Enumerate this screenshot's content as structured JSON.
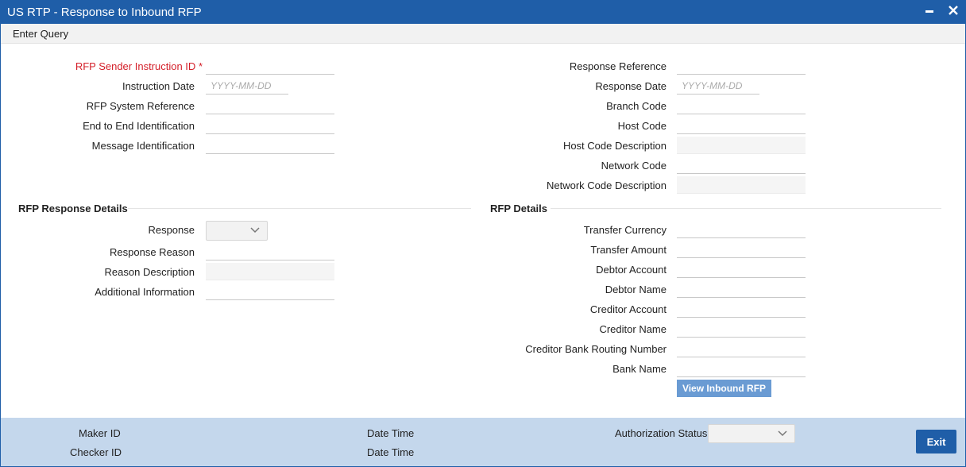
{
  "window": {
    "title": "US RTP - Response to Inbound RFP",
    "minimize_icon": "minimize-icon",
    "close_icon": "close-icon"
  },
  "menu": {
    "enter_query": "Enter Query"
  },
  "header_left": {
    "rfp_sender_instruction_id": {
      "label": "RFP Sender Instruction ID",
      "required_mark": "*",
      "value": ""
    },
    "instruction_date": {
      "label": "Instruction Date",
      "value": "",
      "placeholder": "YYYY-MM-DD"
    },
    "rfp_system_reference": {
      "label": "RFP System Reference",
      "value": ""
    },
    "end_to_end_identification": {
      "label": "End to End Identification",
      "value": ""
    },
    "message_identification": {
      "label": "Message Identification",
      "value": ""
    }
  },
  "header_right": {
    "response_reference": {
      "label": "Response Reference",
      "value": ""
    },
    "response_date": {
      "label": "Response Date",
      "value": "",
      "placeholder": "YYYY-MM-DD"
    },
    "branch_code": {
      "label": "Branch Code",
      "value": ""
    },
    "host_code": {
      "label": "Host Code",
      "value": ""
    },
    "host_code_description": {
      "label": "Host Code Description",
      "value": ""
    },
    "network_code": {
      "label": "Network Code",
      "value": ""
    },
    "network_code_description": {
      "label": "Network Code Description",
      "value": ""
    }
  },
  "rfp_response_details": {
    "title": "RFP Response Details",
    "response": {
      "label": "Response",
      "selected": ""
    },
    "response_reason": {
      "label": "Response Reason",
      "value": ""
    },
    "reason_description": {
      "label": "Reason Description",
      "value": ""
    },
    "additional_information": {
      "label": "Additional Information",
      "value": ""
    }
  },
  "rfp_details": {
    "title": "RFP Details",
    "transfer_currency": {
      "label": "Transfer Currency",
      "value": ""
    },
    "transfer_amount": {
      "label": "Transfer Amount",
      "value": ""
    },
    "debtor_account": {
      "label": "Debtor Account",
      "value": ""
    },
    "debtor_name": {
      "label": "Debtor Name",
      "value": ""
    },
    "creditor_account": {
      "label": "Creditor Account",
      "value": ""
    },
    "creditor_name": {
      "label": "Creditor Name",
      "value": ""
    },
    "creditor_bank_routing_number": {
      "label": "Creditor Bank Routing Number",
      "value": ""
    },
    "bank_name": {
      "label": "Bank Name",
      "value": ""
    },
    "view_button": "View Inbound RFP"
  },
  "footer": {
    "maker_id": "Maker ID",
    "checker_id": "Checker ID",
    "date_time_1": "Date Time",
    "date_time_2": "Date Time",
    "authorization_status": {
      "label": "Authorization Status",
      "selected": ""
    },
    "exit_button": "Exit"
  },
  "colors": {
    "titlebar": "#1f5ea8",
    "required": "#d4202a",
    "footer": "#c4d7ec",
    "view_button": "#6a9bd3"
  }
}
